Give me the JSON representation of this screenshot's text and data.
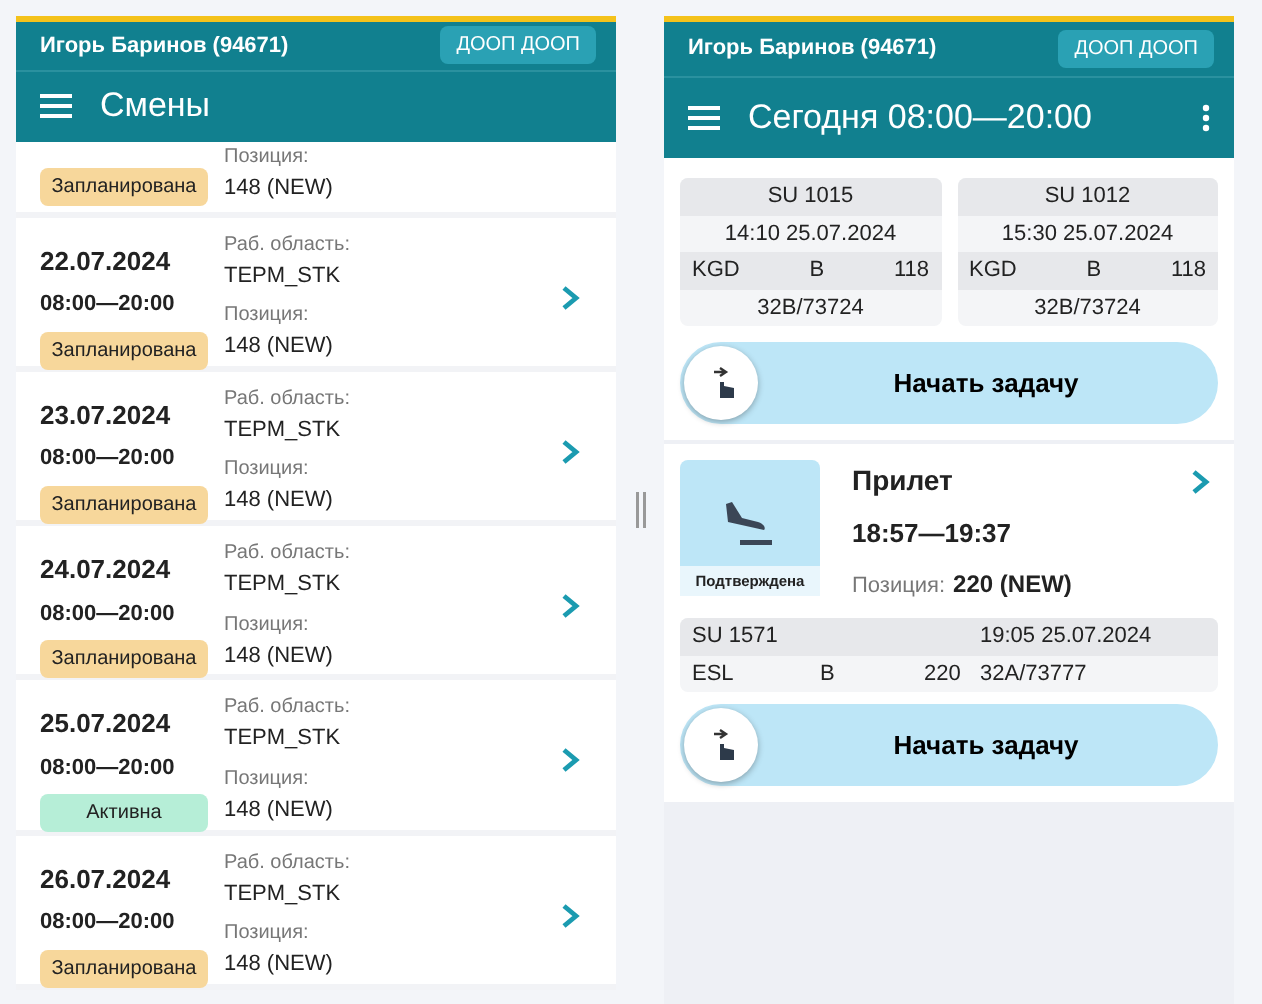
{
  "left": {
    "user": "Игорь Баринов (94671)",
    "org": "ДООП ДООП",
    "title": "Смены",
    "partial_shift": {
      "position_label": "Позиция:",
      "position": "148 (NEW)",
      "status": "Запланирована",
      "color": "#f7d79b"
    },
    "shifts": [
      {
        "date": "22.07.2024",
        "time": "08:00—20:00",
        "status": "Запланирована",
        "color": "#f7d79b",
        "area_label": "Раб. область:",
        "area": "TEPM_STK",
        "position_label": "Позиция:",
        "position": "148 (NEW)"
      },
      {
        "date": "23.07.2024",
        "time": "08:00—20:00",
        "status": "Запланирована",
        "color": "#f7d79b",
        "area_label": "Раб. область:",
        "area": "TEPM_STK",
        "position_label": "Позиция:",
        "position": "148 (NEW)"
      },
      {
        "date": "24.07.2024",
        "time": "08:00—20:00",
        "status": "Запланирована",
        "color": "#f7d79b",
        "area_label": "Раб. область:",
        "area": "TEPM_STK",
        "position_label": "Позиция:",
        "position": "148 (NEW)"
      },
      {
        "date": "25.07.2024",
        "time": "08:00—20:00",
        "status": "Активна",
        "color": "#b6eed7",
        "area_label": "Раб. область:",
        "area": "TEPM_STK",
        "position_label": "Позиция:",
        "position": "148 (NEW)"
      },
      {
        "date": "26.07.2024",
        "time": "08:00—20:00",
        "status": "Запланирована",
        "color": "#f7d79b",
        "area_label": "Раб. область:",
        "area": "TEPM_STK",
        "position_label": "Позиция:",
        "position": "148 (NEW)"
      }
    ]
  },
  "right": {
    "user": "Игорь Баринов (94671)",
    "org": "ДООП ДООП",
    "title": "Сегодня 08:00—20:00",
    "flights": [
      {
        "flight": "SU 1015",
        "datetime": "14:10 25.07.2024",
        "airport": "KGD",
        "terminal": "B",
        "seats": "118",
        "aircraft": "32B/73724"
      },
      {
        "flight": "SU 1012",
        "datetime": "15:30 25.07.2024",
        "airport": "KGD",
        "terminal": "B",
        "seats": "118",
        "aircraft": "32B/73724"
      }
    ],
    "start_button_1": "Начать задачу",
    "task": {
      "title": "Прилет",
      "status": "Подтверждена",
      "time": "18:57—19:37",
      "position_label": "Позиция:",
      "position": "220 (NEW)",
      "flight": "SU 1571",
      "datetime": "19:05 25.07.2024",
      "airport": "ESL",
      "terminal": "B",
      "seats": "220",
      "aircraft": "32A/73777"
    },
    "start_button_2": "Начать задачу"
  }
}
